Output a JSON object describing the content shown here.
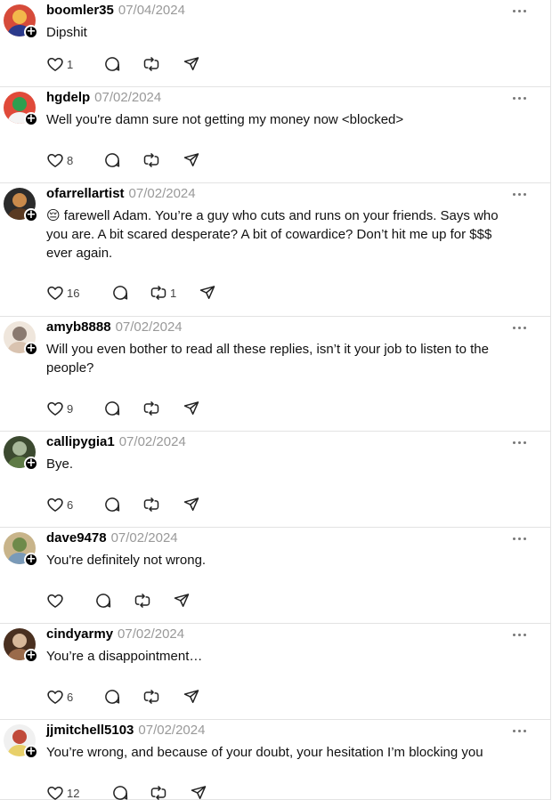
{
  "posts": [
    {
      "username": "boomler35",
      "date": "07/04/2024",
      "text": "Dipshit",
      "likes": "1",
      "reposts": "",
      "avatar_colors": [
        "#2b3a8c",
        "#f2b84b",
        "#d64b3a"
      ]
    },
    {
      "username": "hgdelp",
      "date": "07/02/2024",
      "text": "Well you're damn sure not getting my money now <blocked>",
      "likes": "8",
      "reposts": "",
      "avatar_colors": [
        "#f4f4f4",
        "#2e9e4f",
        "#e04a3a"
      ]
    },
    {
      "username": "ofarrellartist",
      "date": "07/02/2024",
      "text": "😔 farewell Adam. You’re a guy who cuts and runs on your friends. Says who you are. A bit scared desperate? A bit of cowardice? Don’t hit me up for $$$ ever again.",
      "likes": "16",
      "reposts": "1",
      "avatar_colors": [
        "#5a3a22",
        "#c98a4b",
        "#2b2b2b"
      ]
    },
    {
      "username": "amyb8888",
      "date": "07/02/2024",
      "text": "Will you even bother to read all these replies, isn’t it your job to listen to the people?",
      "likes": "9",
      "reposts": "",
      "avatar_colors": [
        "#d9c3b0",
        "#8a7a70",
        "#efe6dc"
      ]
    },
    {
      "username": "callipygia1",
      "date": "07/02/2024",
      "text": "Bye.",
      "likes": "6",
      "reposts": "",
      "avatar_colors": [
        "#5e7a45",
        "#a8b89a",
        "#3c4a30"
      ]
    },
    {
      "username": "dave9478",
      "date": "07/02/2024",
      "text": "You're definitely not wrong.",
      "likes": "",
      "reposts": "",
      "avatar_colors": [
        "#7a9ab8",
        "#6e8a4a",
        "#c8b48a"
      ]
    },
    {
      "username": "cindyarmy",
      "date": "07/02/2024",
      "text": "You’re a disappointment…",
      "likes": "6",
      "reposts": "",
      "avatar_colors": [
        "#9a6a4a",
        "#d8b89a",
        "#4a3020"
      ]
    },
    {
      "username": "jjmitchell5103",
      "date": "07/02/2024",
      "text": "You’re wrong, and because of your doubt, your hesitation I’m blocking you",
      "likes": "12",
      "reposts": "",
      "avatar_colors": [
        "#e8d06a",
        "#c04a3a",
        "#f0f0f0"
      ]
    }
  ],
  "icons": {
    "follow": "plus-icon",
    "more": "more-horizontal-icon",
    "like": "heart-icon",
    "reply": "comment-icon",
    "repost": "repost-icon",
    "share": "send-icon"
  }
}
